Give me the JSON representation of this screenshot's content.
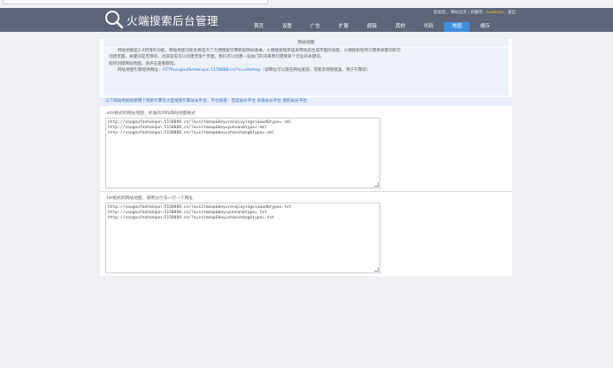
{
  "header": {
    "title": "火端搜索后台管理",
    "user_prefix": "欢迎您，",
    "user_links": [
      "网站首页",
      "的缓存",
      "huoduan",
      "退出"
    ]
  },
  "nav": {
    "items": [
      "首页",
      "设置",
      "广告",
      "扩展",
      "超链",
      "其他",
      "代码",
      "地图",
      "缓存"
    ],
    "active_index": 7,
    "active_color": "#3f8fe0"
  },
  "panel": {
    "title": "网站地图",
    "intro_lines": [
      "网站地图是2.X新增的功能，网站地图功能主要是为了方便搜索引擎抓取网站收录。火端搜索程序是采用动态生成页面的功能，火端搜索程序只需要关键词就可",
      "创建页面，关键词是无限的，也就是说可以创建无限个页面。我们可以创建一些站门的词来我们需要某个行业的关键词。",
      "如何创建网站地图，请点击查看教程。"
    ],
    "url_label": "网站地图引擎提供网址：",
    "url_value": "HTTPsougoufanhanqun.5158888.cn/?a=sitemap",
    "url_note": "（该网址可以放在网站底部，或者友情链接里，用于引擎抓）",
    "note": "以下网站地图按使用下搜索引擎在大型搜索引擎站长平台，平台链接：百度站长平台 谷歌站长平台 搜狗站长平台",
    "xml_header": ".xml格式的网站地图，标准的XML网站地图格式",
    "xml_lines": [
      "http://sougoufanhanqun.5158888.cn/?a=sitemap&key=renqiuyingxiaowd&type=.xml",
      "http://sougoufanhanqun.5158888.cn/?a=sitemap&key=yunnan&type=.xml",
      "http://sougoufanhanqun.5158888.cn/?a=sitemap&key=shanshang&type=.xml"
    ],
    "txt_header": ".txt格式的网站地图，请用分行法一行一个网址",
    "txt_lines": [
      "http://sougoufanhanqun.5158888.cn/?a=sitemap&key=renqiuyingxiaowd&type=.txt",
      "http://sougoufanhanqun.5158888.cn/?a=sitemap&key=yunnan&type=.txt",
      "http://sougoufanhanqun.5158888.cn/?a=sitemap&key=shanshang&type=.txt"
    ]
  }
}
